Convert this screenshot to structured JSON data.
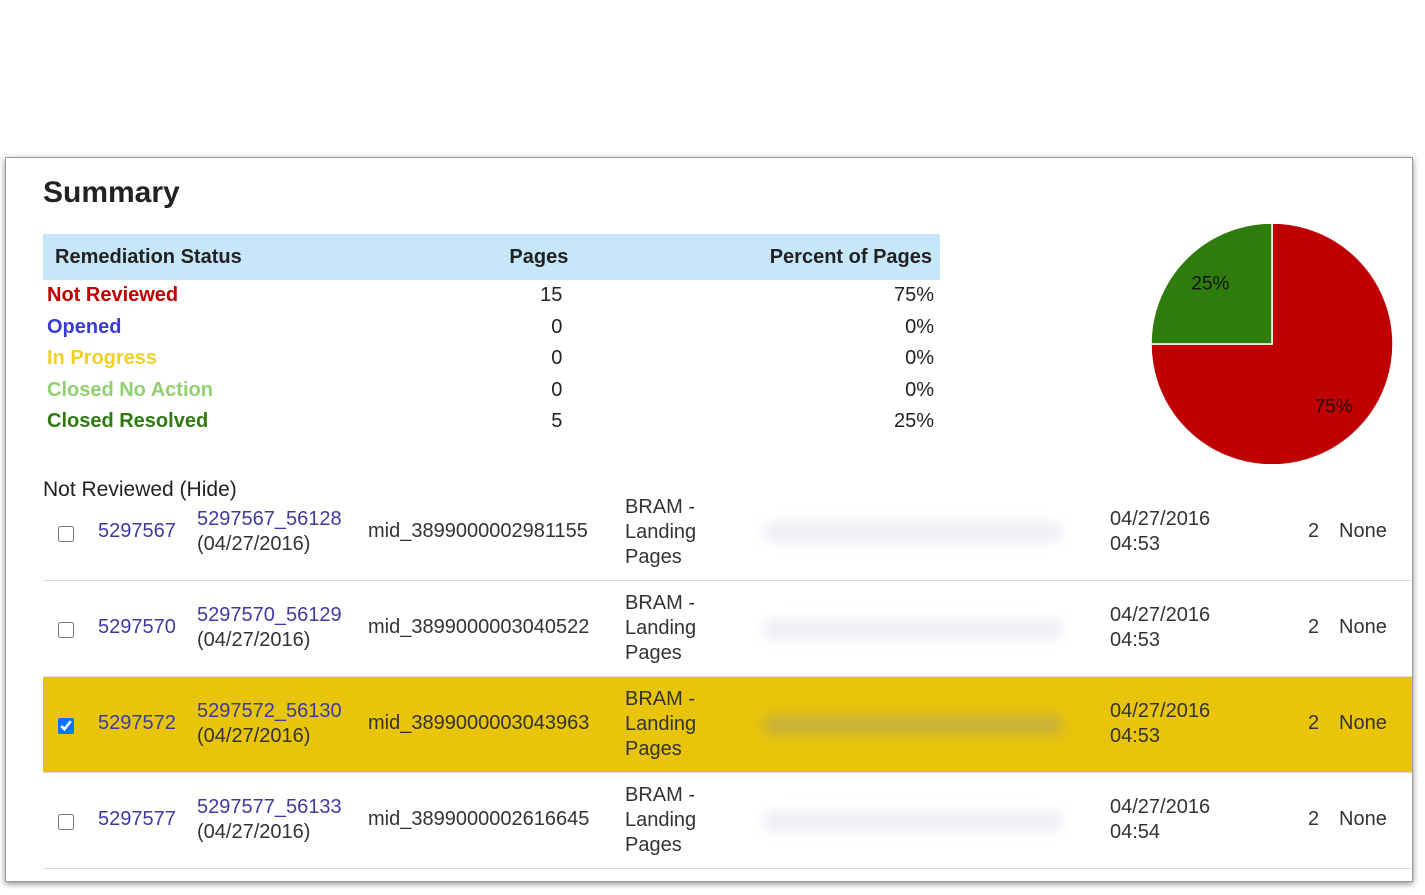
{
  "summary": {
    "title": "Summary",
    "headers": [
      "Remediation Status",
      "Pages",
      "Percent of Pages"
    ],
    "rows": [
      {
        "status": "Not Reviewed",
        "pages": "15",
        "percent": "75%",
        "color": "#c00000"
      },
      {
        "status": "Opened",
        "pages": "0",
        "percent": "0%",
        "color": "#3b3bd8"
      },
      {
        "status": "In Progress",
        "pages": "0",
        "percent": "0%",
        "color": "#f2d024"
      },
      {
        "status": "Closed No Action",
        "pages": "0",
        "percent": "0%",
        "color": "#90d070"
      },
      {
        "status": "Closed Resolved",
        "pages": "5",
        "percent": "25%",
        "color": "#2f7a10"
      }
    ]
  },
  "chart_data": {
    "type": "pie",
    "slices": [
      {
        "label": "75%",
        "value": 75,
        "color": "#c00000"
      },
      {
        "label": "25%",
        "value": 25,
        "color": "#2e7d0c"
      }
    ]
  },
  "not_reviewed": {
    "label": "Not Reviewed (Hide)",
    "rows": [
      {
        "checked": false,
        "id": "5297567",
        "job": "5297567_56128",
        "job_date": "(04/27/2016)",
        "mid": "mid_3899000002981155",
        "category": "BRAM - Landing Pages",
        "date": "04/27/2016",
        "time": "04:53",
        "count": "2",
        "owner": "None"
      },
      {
        "checked": false,
        "id": "5297570",
        "job": "5297570_56129",
        "job_date": "(04/27/2016)",
        "mid": "mid_3899000003040522",
        "category": "BRAM - Landing Pages",
        "date": "04/27/2016",
        "time": "04:53",
        "count": "2",
        "owner": "None"
      },
      {
        "checked": true,
        "id": "5297572",
        "job": "5297572_56130",
        "job_date": "(04/27/2016)",
        "mid": "mid_3899000003043963",
        "category": "BRAM - Landing Pages",
        "date": "04/27/2016",
        "time": "04:53",
        "count": "2",
        "owner": "None"
      },
      {
        "checked": false,
        "id": "5297577",
        "job": "5297577_56133",
        "job_date": "(04/27/2016)",
        "mid": "mid_3899000002616645",
        "category": "BRAM - Landing Pages",
        "date": "04/27/2016",
        "time": "04:54",
        "count": "2",
        "owner": "None"
      }
    ]
  }
}
